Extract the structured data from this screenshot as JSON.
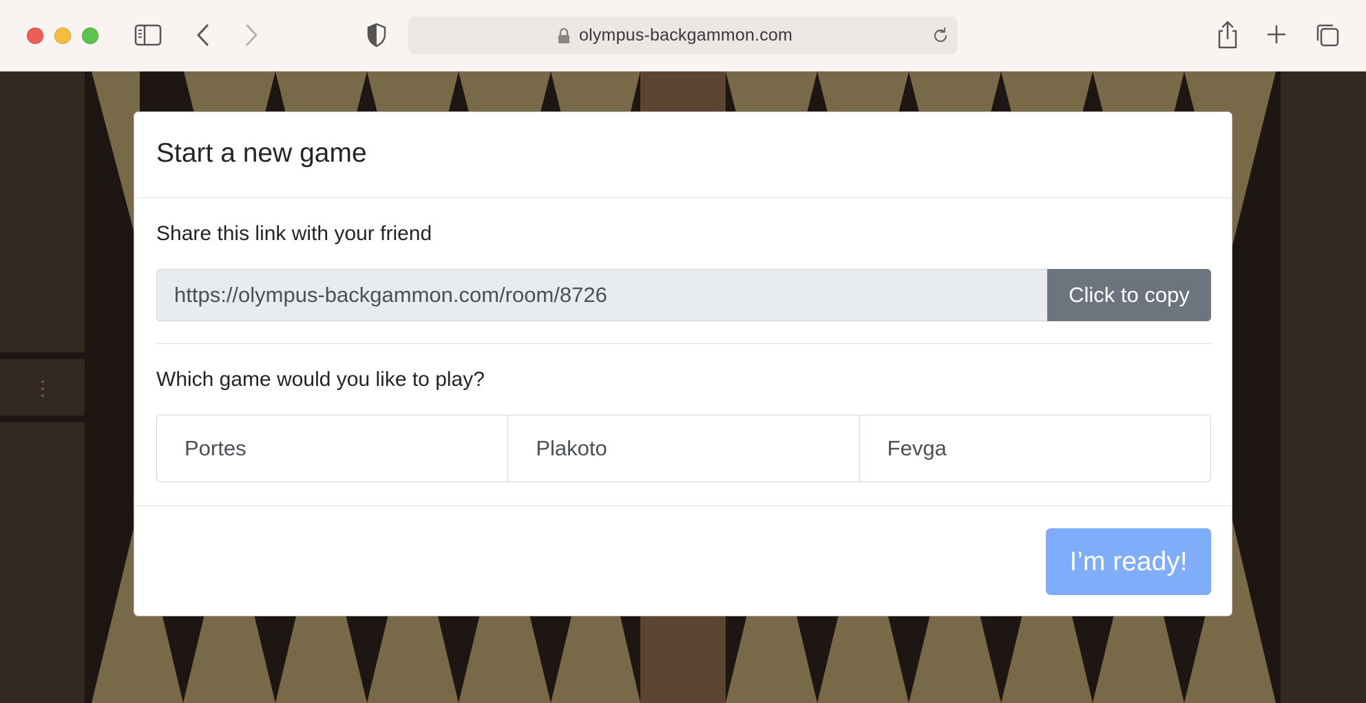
{
  "browser": {
    "url": "olympus-backgammon.com",
    "icons": [
      "sidebar-icon",
      "back-icon",
      "forward-icon",
      "shield-icon",
      "lock-icon",
      "reload-icon",
      "share-icon",
      "new-tab-icon",
      "tabs-icon"
    ]
  },
  "colors": {
    "board_light": "#786a48",
    "board_dark": "#1e1613",
    "bar": "#5d4631",
    "frame": "#342920",
    "ready_button": "#7fadf9",
    "copy_button": "#6c757d"
  },
  "modal": {
    "title": "Start a new game",
    "share_label": "Share this link with your friend",
    "link_value": "https://olympus-backgammon.com/room/8726",
    "copy_button": "Click to copy",
    "game_question": "Which game would you like to play?",
    "games": [
      "Portes",
      "Plakoto",
      "Fevga"
    ],
    "ready_button": "I’m ready!"
  }
}
